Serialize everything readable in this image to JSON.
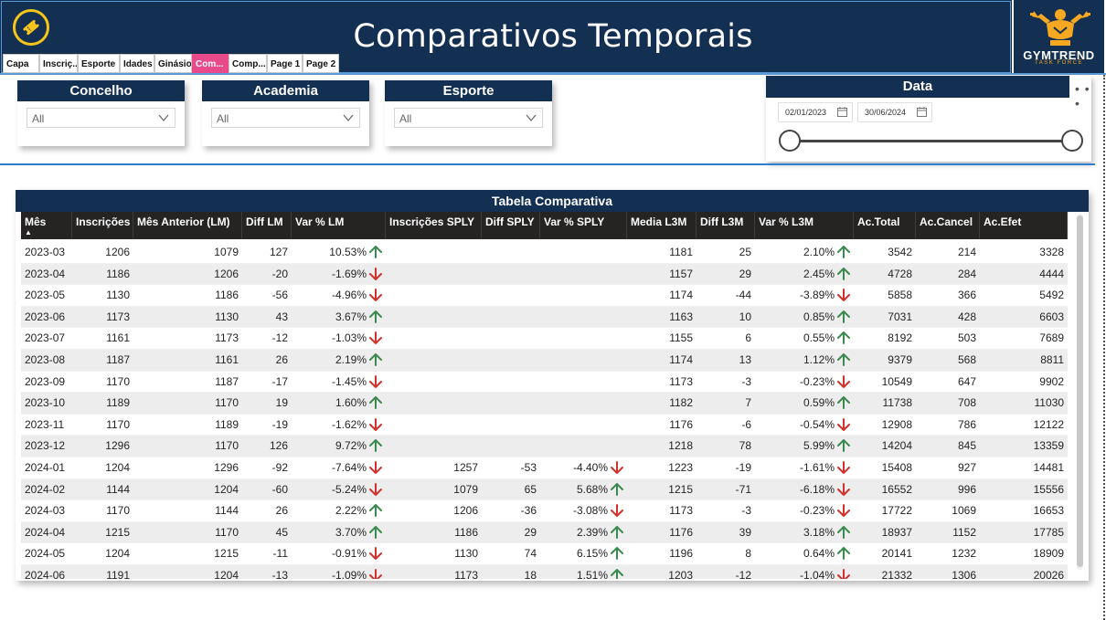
{
  "header": {
    "title": "Comparativos Temporais",
    "brand_name": "GYMTREND",
    "brand_sub": "TASK FORCE",
    "tabs": [
      "Capa",
      "Inscriç...",
      "Esporte",
      "Idades",
      "Ginásios",
      "Com...",
      "Comp...",
      "Page 1",
      "Page 2"
    ],
    "active_tab": 5,
    "accent": "#132f52",
    "active_tab_color": "#e84a8a"
  },
  "filters": [
    {
      "label": "Concelho",
      "value": "All"
    },
    {
      "label": "Academia",
      "value": "All"
    },
    {
      "label": "Esporte",
      "value": "All"
    }
  ],
  "date_slicer": {
    "label": "Data",
    "start": "02/01/2023",
    "end": "30/06/2024",
    "more": "• • •"
  },
  "table": {
    "title": "Tabela Comparativa",
    "columns": [
      "Mês",
      "Inscrições",
      "Mês Anterior (LM)",
      "Diff LM",
      "Var % LM",
      "Inscrições SPLY",
      "Diff SPLY",
      "Var % SPLY",
      "Media L3M",
      "Diff L3M",
      "Var % L3M",
      "Ac.Total",
      "Ac.Cancel",
      "Ac.Efet"
    ],
    "sort_indicator": "▲",
    "rows": [
      [
        "2023-03",
        "1206",
        "1079",
        "127",
        "10.53%",
        "up",
        "",
        "",
        "",
        "",
        "1181",
        "25",
        "2.10%",
        "up",
        "3542",
        "214",
        "3328"
      ],
      [
        "2023-04",
        "1186",
        "1206",
        "-20",
        "-1.69%",
        "down",
        "",
        "",
        "",
        "",
        "1157",
        "29",
        "2.45%",
        "up",
        "4728",
        "284",
        "4444"
      ],
      [
        "2023-05",
        "1130",
        "1186",
        "-56",
        "-4.96%",
        "down",
        "",
        "",
        "",
        "",
        "1174",
        "-44",
        "-3.89%",
        "down",
        "5858",
        "366",
        "5492"
      ],
      [
        "2023-06",
        "1173",
        "1130",
        "43",
        "3.67%",
        "up",
        "",
        "",
        "",
        "",
        "1163",
        "10",
        "0.85%",
        "up",
        "7031",
        "428",
        "6603"
      ],
      [
        "2023-07",
        "1161",
        "1173",
        "-12",
        "-1.03%",
        "down",
        "",
        "",
        "",
        "",
        "1155",
        "6",
        "0.55%",
        "up",
        "8192",
        "503",
        "7689"
      ],
      [
        "2023-08",
        "1187",
        "1161",
        "26",
        "2.19%",
        "up",
        "",
        "",
        "",
        "",
        "1174",
        "13",
        "1.12%",
        "up",
        "9379",
        "568",
        "8811"
      ],
      [
        "2023-09",
        "1170",
        "1187",
        "-17",
        "-1.45%",
        "down",
        "",
        "",
        "",
        "",
        "1173",
        "-3",
        "-0.23%",
        "down",
        "10549",
        "647",
        "9902"
      ],
      [
        "2023-10",
        "1189",
        "1170",
        "19",
        "1.60%",
        "up",
        "",
        "",
        "",
        "",
        "1182",
        "7",
        "0.59%",
        "up",
        "11738",
        "708",
        "11030"
      ],
      [
        "2023-11",
        "1170",
        "1189",
        "-19",
        "-1.62%",
        "down",
        "",
        "",
        "",
        "",
        "1176",
        "-6",
        "-0.54%",
        "down",
        "12908",
        "786",
        "12122"
      ],
      [
        "2023-12",
        "1296",
        "1170",
        "126",
        "9.72%",
        "up",
        "",
        "",
        "",
        "",
        "1218",
        "78",
        "5.99%",
        "up",
        "14204",
        "845",
        "13359"
      ],
      [
        "2024-01",
        "1204",
        "1296",
        "-92",
        "-7.64%",
        "down",
        "1257",
        "-53",
        "-4.40%",
        "down",
        "1223",
        "-19",
        "-1.61%",
        "down",
        "15408",
        "927",
        "14481"
      ],
      [
        "2024-02",
        "1144",
        "1204",
        "-60",
        "-5.24%",
        "down",
        "1079",
        "65",
        "5.68%",
        "up",
        "1215",
        "-71",
        "-6.18%",
        "down",
        "16552",
        "996",
        "15556"
      ],
      [
        "2024-03",
        "1170",
        "1144",
        "26",
        "2.22%",
        "up",
        "1206",
        "-36",
        "-3.08%",
        "down",
        "1173",
        "-3",
        "-0.23%",
        "down",
        "17722",
        "1069",
        "16653"
      ],
      [
        "2024-04",
        "1215",
        "1170",
        "45",
        "3.70%",
        "up",
        "1186",
        "29",
        "2.39%",
        "up",
        "1176",
        "39",
        "3.18%",
        "up",
        "18937",
        "1152",
        "17785"
      ],
      [
        "2024-05",
        "1204",
        "1215",
        "-11",
        "-0.91%",
        "down",
        "1130",
        "74",
        "6.15%",
        "up",
        "1196",
        "8",
        "0.64%",
        "up",
        "20141",
        "1232",
        "18909"
      ],
      [
        "2024-06",
        "1191",
        "1204",
        "-13",
        "-1.09%",
        "down",
        "1173",
        "18",
        "1.51%",
        "up",
        "1203",
        "-12",
        "-1.04%",
        "down",
        "21332",
        "1306",
        "20026"
      ]
    ],
    "up_color": "#3a8a4f",
    "down_color": "#d2322b"
  }
}
